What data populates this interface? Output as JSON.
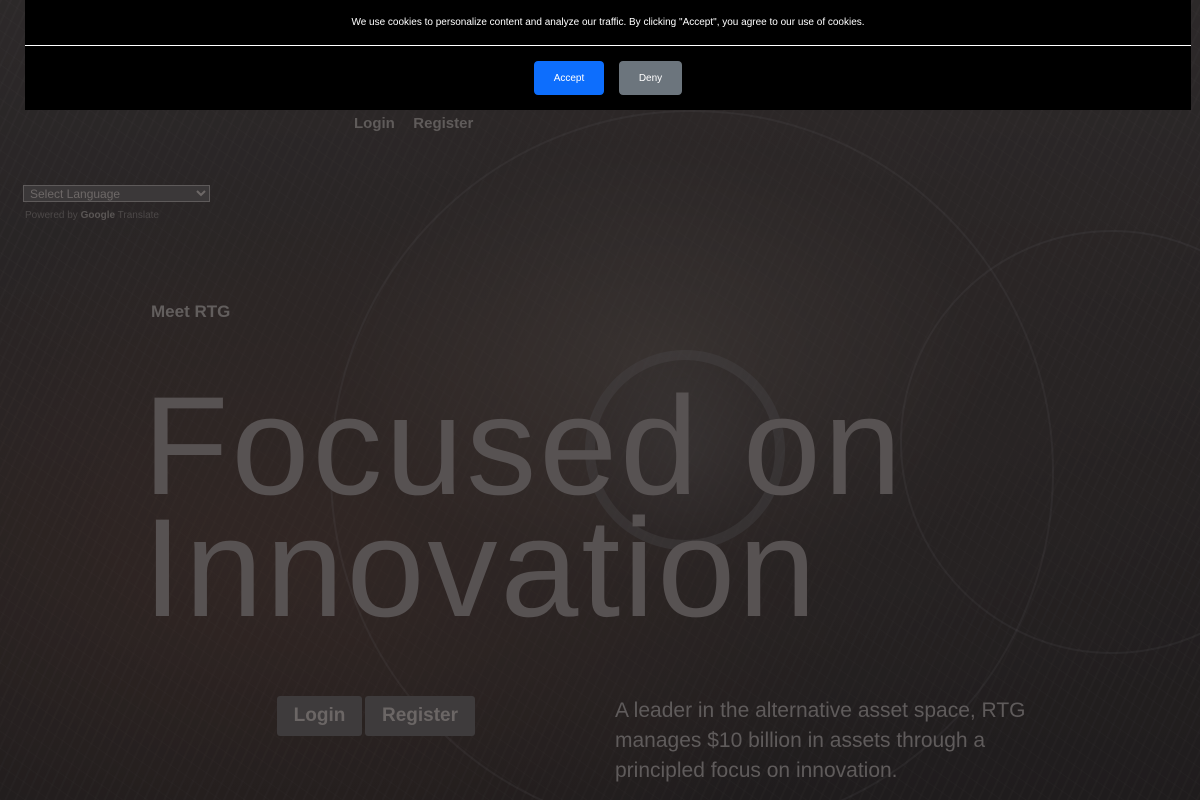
{
  "cookie_banner": {
    "message": "We use cookies to personalize content and analyze our traffic. By clicking \"Accept\", you agree to our use of cookies.",
    "accept_label": "Accept",
    "deny_label": "Deny",
    "accept_color": "#0d6efd",
    "deny_color": "#6c757d"
  },
  "nav": {
    "login_label": "Login",
    "register_label": "Register"
  },
  "translate": {
    "select_placeholder": "Select Language",
    "powered_by": "Powered by",
    "google": "Google",
    "translate": "Translate"
  },
  "hero": {
    "eyebrow": "Meet RTG",
    "headline_line1": "Focused on",
    "headline_line2": "Innovation",
    "login_label": "Login",
    "register_label": "Register",
    "tagline": "A leader in the alternative asset space, RTG manages $10 billion in assets through a principled focus on innovation."
  }
}
